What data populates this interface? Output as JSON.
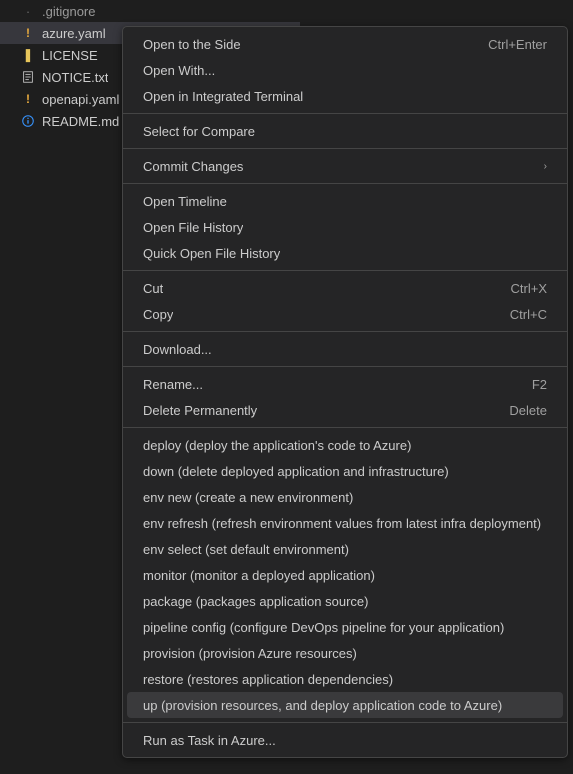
{
  "files": [
    {
      "icon": "gitignore",
      "label": ".gitignore"
    },
    {
      "icon": "yaml",
      "label": "azure.yaml",
      "selected": true
    },
    {
      "icon": "license",
      "label": "LICENSE"
    },
    {
      "icon": "text",
      "label": "NOTICE.txt"
    },
    {
      "icon": "yaml",
      "label": "openapi.yaml"
    },
    {
      "icon": "info",
      "label": "README.md"
    }
  ],
  "menu": {
    "groups": [
      [
        {
          "label": "Open to the Side",
          "shortcut": "Ctrl+Enter"
        },
        {
          "label": "Open With..."
        },
        {
          "label": "Open in Integrated Terminal"
        }
      ],
      [
        {
          "label": "Select for Compare"
        }
      ],
      [
        {
          "label": "Commit Changes",
          "submenu": true
        }
      ],
      [
        {
          "label": "Open Timeline"
        },
        {
          "label": "Open File History"
        },
        {
          "label": "Quick Open File History"
        }
      ],
      [
        {
          "label": "Cut",
          "shortcut": "Ctrl+X"
        },
        {
          "label": "Copy",
          "shortcut": "Ctrl+C"
        }
      ],
      [
        {
          "label": "Download..."
        }
      ],
      [
        {
          "label": "Rename...",
          "shortcut": "F2"
        },
        {
          "label": "Delete Permanently",
          "shortcut": "Delete"
        }
      ],
      [
        {
          "label": "deploy (deploy the application's code to Azure)"
        },
        {
          "label": "down (delete deployed application and infrastructure)"
        },
        {
          "label": "env new (create a new environment)"
        },
        {
          "label": "env refresh (refresh environment values from latest infra deployment)"
        },
        {
          "label": "env select (set default environment)"
        },
        {
          "label": "monitor (monitor a deployed application)"
        },
        {
          "label": "package (packages application source)"
        },
        {
          "label": "pipeline config (configure DevOps pipeline for your application)"
        },
        {
          "label": "provision (provision Azure resources)"
        },
        {
          "label": "restore (restores application dependencies)"
        },
        {
          "label": "up (provision resources, and deploy application code to Azure)",
          "highlighted": true
        }
      ],
      [
        {
          "label": "Run as Task in Azure..."
        }
      ]
    ]
  }
}
